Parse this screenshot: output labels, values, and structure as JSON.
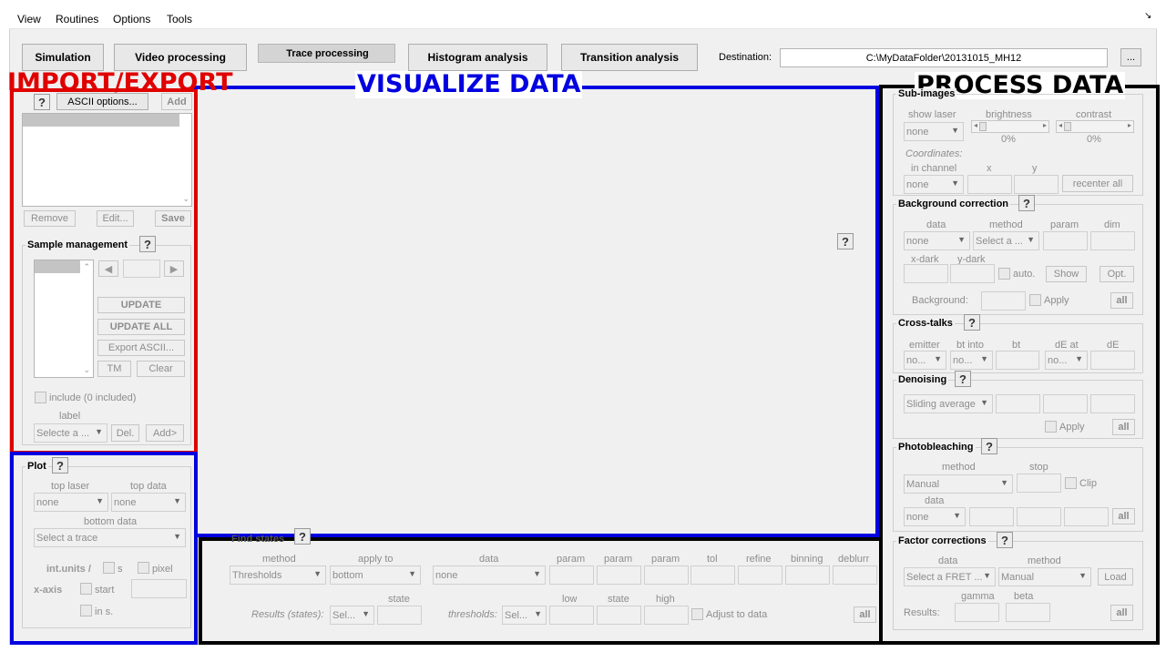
{
  "menu": [
    "View",
    "Routines",
    "Options",
    "Tools"
  ],
  "menu_arrow": "↘",
  "tabs": {
    "simulation": "Simulation",
    "video": "Video processing",
    "trace": "Trace processing",
    "histogram": "Histogram analysis",
    "transition": "Transition analysis"
  },
  "destination": {
    "label": "Destination:",
    "value": "C:\\MyDataFolder\\20131015_MH12",
    "browse": "..."
  },
  "annotations": {
    "import_export": "IMPORT/EXPORT",
    "visualize": "VISUALIZE DATA",
    "process": "PROCESS DATA"
  },
  "annotation_colors": {
    "import_export": "#e00000",
    "visualize": "#0000e0",
    "process": "#000000"
  },
  "help_glyph": "?",
  "import": {
    "ascii_options": "ASCII options...",
    "add": "Add",
    "remove": "Remove",
    "edit": "Edit...",
    "save": "Save"
  },
  "sample": {
    "title": "Sample management",
    "update": "UPDATE",
    "update_all": "UPDATE ALL",
    "export_ascii": "Export ASCII...",
    "tm": "TM",
    "clear": "Clear",
    "include": "include (0 included)",
    "label": "label",
    "label_select": "Selecte a ...",
    "del": "Del.",
    "add": "Add>"
  },
  "plot": {
    "title": "Plot",
    "top_laser": "top laser",
    "top_data": "top data",
    "top_laser_value": "none",
    "top_data_value": "none",
    "bottom_data": "bottom data",
    "bottom_value": "Select a trace",
    "int_units": "int.units /",
    "s": "s",
    "pixel": "pixel",
    "x_axis": "x-axis",
    "start": "start",
    "in_s": "in s."
  },
  "find_states": {
    "title": "Find states",
    "method": "method",
    "apply_to": "apply to",
    "data": "data",
    "param": "param",
    "tol": "tol",
    "refine": "refine",
    "binning": "binning",
    "deblurr": "deblurr",
    "method_value": "Thresholds",
    "apply_value": "bottom",
    "data_value": "none",
    "state": "state",
    "low": "low",
    "high": "high",
    "results": "Results (states):",
    "results_sel": "Sel...",
    "thresholds": "thresholds:",
    "thresholds_sel": "Sel...",
    "adjust": "Adjust to data",
    "all": "all"
  },
  "sub_images": {
    "title": "Sub-images",
    "show_laser": "show laser",
    "brightness": "brightness",
    "contrast": "contrast",
    "laser_value": "none",
    "brightness_pct": "0%",
    "contrast_pct": "0%",
    "coordinates": "Coordinates:",
    "in_channel": "in channel",
    "x": "x",
    "y": "y",
    "channel_value": "none",
    "recenter": "recenter all"
  },
  "background": {
    "title": "Background correction",
    "data": "data",
    "method": "method",
    "param": "param",
    "dim": "dim",
    "data_value": "none",
    "method_value": "Select a ...",
    "x_dark": "x-dark",
    "y_dark": "y-dark",
    "auto": "auto.",
    "show": "Show",
    "opt": "Opt.",
    "background": "Background:",
    "apply": "Apply",
    "all": "all"
  },
  "crosstalk": {
    "title": "Cross-talks",
    "emitter": "emitter",
    "bt_into": "bt into",
    "bt": "bt",
    "de_at": "dE at",
    "de": "dE",
    "emitter_value": "no...",
    "bt_into_value": "no...",
    "de_at_value": "no..."
  },
  "denoising": {
    "title": "Denoising",
    "method_value": "Sliding average",
    "apply": "Apply",
    "all": "all"
  },
  "photobleaching": {
    "title": "Photobleaching",
    "method": "method",
    "stop": "stop",
    "method_value": "Manual",
    "clip": "Clip",
    "data": "data",
    "data_value": "none",
    "all": "all"
  },
  "factor": {
    "title": "Factor corrections",
    "data": "data",
    "method": "method",
    "data_value": "Select a FRET ...",
    "method_value": "Manual",
    "load": "Load",
    "gamma": "gamma",
    "beta": "beta",
    "results": "Results:",
    "all": "all"
  }
}
